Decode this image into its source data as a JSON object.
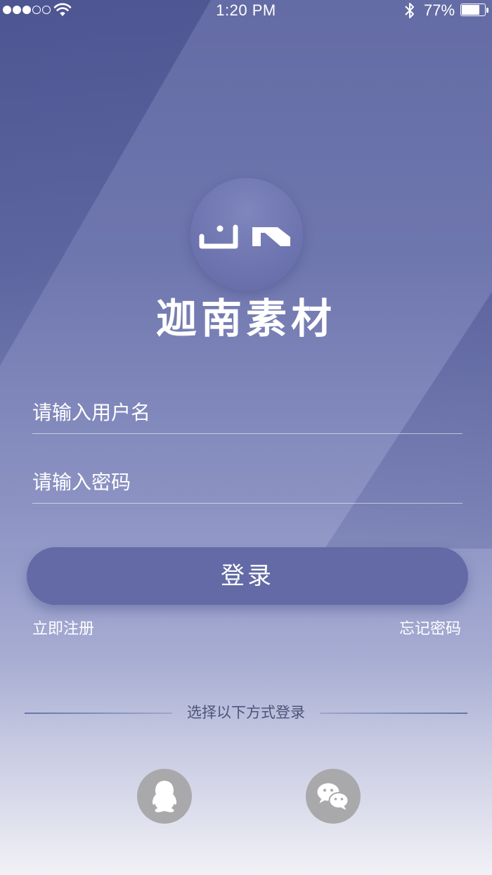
{
  "status_bar": {
    "time": "1:20 PM",
    "battery_text": "77%",
    "battery_level": 0.77,
    "signal_bars_filled": 3,
    "signal_bars_total": 5
  },
  "app": {
    "logo_text": "JN",
    "name": "迦南素材"
  },
  "form": {
    "username_placeholder": "请输入用户名",
    "password_placeholder": "请输入密码",
    "login_label": "登录"
  },
  "links": {
    "register": "立即注册",
    "forgot_password": "忘记密码"
  },
  "social": {
    "divider_text": "选择以下方式登录",
    "options": [
      {
        "icon": "qq-icon"
      },
      {
        "icon": "wechat-icon"
      }
    ]
  },
  "colors": {
    "background_top": "#5c64a0",
    "background_bottom": "#f1f1f6",
    "button": "#636aa5",
    "social_button": "#a9a9ac",
    "divider_text": "#4b5479"
  }
}
